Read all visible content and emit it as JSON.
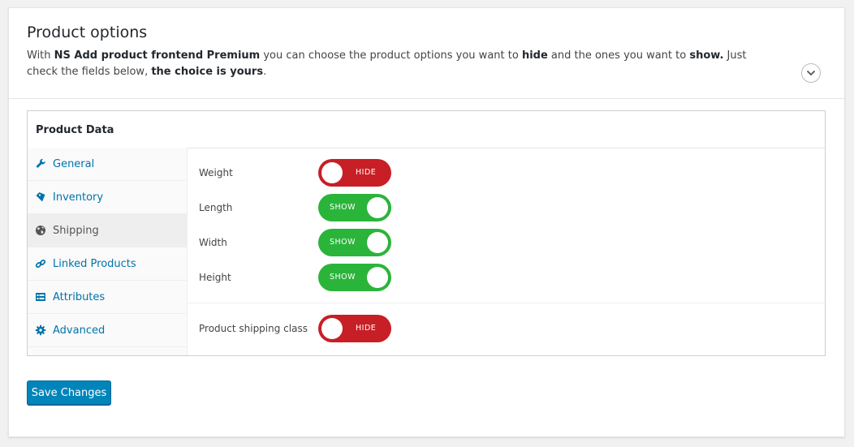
{
  "header": {
    "title": "Product options",
    "desc_1": "With ",
    "desc_plugin": "NS Add product frontend Premium",
    "desc_2": " you can choose the product options you want to ",
    "desc_hide": "hide",
    "desc_3": " and the ones you want to ",
    "desc_show": "show.",
    "desc_4": " Just check the fields below, ",
    "desc_choice": "the choice is yours",
    "desc_5": "."
  },
  "product_data": {
    "title": "Product Data",
    "tabs": [
      {
        "label": "General",
        "icon": "wrench-icon"
      },
      {
        "label": "Inventory",
        "icon": "tag-icon"
      },
      {
        "label": "Shipping",
        "icon": "globe-icon",
        "active": true
      },
      {
        "label": "Linked Products",
        "icon": "link-icon"
      },
      {
        "label": "Attributes",
        "icon": "list-icon"
      },
      {
        "label": "Advanced",
        "icon": "gear-icon"
      }
    ],
    "options": [
      {
        "label": "Weight",
        "state": "HIDE"
      },
      {
        "label": "Length",
        "state": "SHOW"
      },
      {
        "label": "Width",
        "state": "SHOW"
      },
      {
        "label": "Height",
        "state": "SHOW"
      },
      {
        "label": "Product shipping class",
        "state": "HIDE"
      }
    ]
  },
  "save_label": "Save Changes",
  "colors": {
    "hide": "#c71f25",
    "show": "#2bb43a",
    "link": "#0073aa",
    "button": "#0085ba"
  }
}
